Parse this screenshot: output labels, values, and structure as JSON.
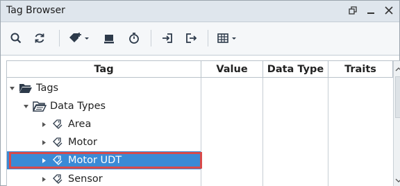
{
  "window": {
    "title": "Tag Browser",
    "controls": [
      "restore-icon",
      "minimize-icon",
      "close-icon"
    ]
  },
  "toolbar": {
    "buttons": [
      {
        "name": "search-icon"
      },
      {
        "name": "refresh-icon"
      },
      {
        "name": "add-tag-menu-icon"
      },
      {
        "name": "database-icon"
      },
      {
        "name": "timer-icon"
      },
      {
        "name": "import-icon"
      },
      {
        "name": "export-icon"
      },
      {
        "name": "table-view-menu-icon"
      }
    ]
  },
  "grid": {
    "columns": [
      "Tag",
      "Value",
      "Data Type",
      "Traits"
    ],
    "rows": [
      {
        "label": "Tags",
        "expanded": true,
        "icon": "folder-open-icon",
        "level": 0
      },
      {
        "label": "Data Types",
        "expanded": true,
        "icon": "folder-open-icon",
        "level": 1
      },
      {
        "label": "Area",
        "expanded": false,
        "icon": "tag-icon",
        "level": 2
      },
      {
        "label": "Motor",
        "expanded": false,
        "icon": "tag-icon",
        "level": 2
      },
      {
        "label": "Motor UDT",
        "expanded": false,
        "icon": "tag-icon",
        "level": 2,
        "selected": true
      },
      {
        "label": "Sensor",
        "expanded": false,
        "icon": "tag-icon",
        "level": 2
      }
    ]
  },
  "colors": {
    "selection": "#3a8ad6",
    "highlight_border": "#d94a4a",
    "titlebar": "#dfe6ed"
  }
}
